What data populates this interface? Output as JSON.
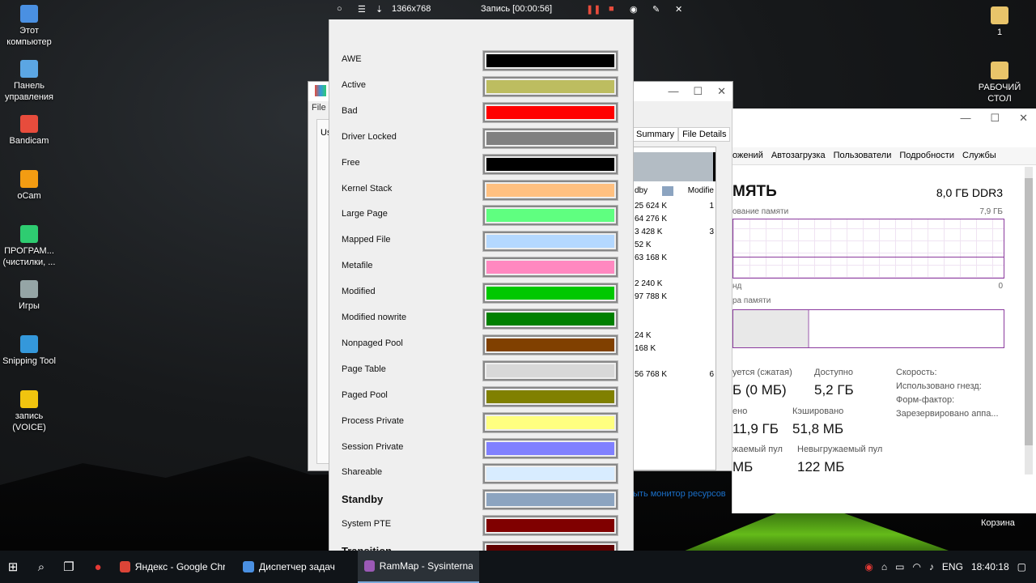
{
  "recorder": {
    "resolution": "1366x768",
    "recording": "Запись [00:00:56]"
  },
  "desktop_icons": [
    {
      "label": "Этот компьютер",
      "color": "#4a90e2"
    },
    {
      "label": "Панель управления",
      "color": "#5ba6e3"
    },
    {
      "label": "Bandicam",
      "color": "#e74c3c"
    },
    {
      "label": "oCam",
      "color": "#f39c12"
    },
    {
      "label": "ПРОГРАМ... (чистилки, ...",
      "color": "#2ecc71"
    },
    {
      "label": "Игры",
      "color": "#95a5a6"
    },
    {
      "label": "Snipping Tool",
      "color": "#3498db"
    },
    {
      "label": "запись (VOICE)",
      "color": "#f1c40f"
    }
  ],
  "right_icons": [
    {
      "label": "1"
    },
    {
      "label": "РАБОЧИЙ СТОЛ"
    }
  ],
  "rammap_window": {
    "menu": "File",
    "tabs": [
      "Summary",
      "File Details"
    ],
    "partial_tab": "Us",
    "header": {
      "col1": "dby",
      "col2": "Modifie"
    },
    "rows": [
      {
        "a": "25 624 K",
        "b": "1"
      },
      {
        "a": "64 276 K",
        "b": ""
      },
      {
        "a": "3 428 K",
        "b": "3"
      },
      {
        "a": "52 K",
        "b": ""
      },
      {
        "a": "63 168 K",
        "b": ""
      },
      {
        "a": "",
        "b": ""
      },
      {
        "a": "2 240 K",
        "b": ""
      },
      {
        "a": "97 788 K",
        "b": ""
      },
      {
        "a": "",
        "b": ""
      },
      {
        "a": "",
        "b": ""
      },
      {
        "a": "24 K",
        "b": ""
      },
      {
        "a": "168 K",
        "b": ""
      },
      {
        "a": "",
        "b": ""
      },
      {
        "a": "56 768 K",
        "b": "6"
      }
    ],
    "link": "ыть монитор ресурсов"
  },
  "task_manager": {
    "tabs": [
      "ожений",
      "Автозагрузка",
      "Пользователи",
      "Подробности",
      "Службы"
    ],
    "title": "мять",
    "spec": "8,0 ГБ DDR3",
    "usage_label": "ование памяти",
    "usage_max": "7,9 ГБ",
    "axis_left": "нд",
    "axis_right": "0",
    "composition_label": "ра памяти",
    "stats": {
      "in_use_label": "уется (сжатая)",
      "in_use_value": "Б (0 МБ)",
      "available_label": "Доступно",
      "available_value": "5,2 ГБ",
      "speed_label": "Скорость:",
      "slots_label": "Использовано гнезд:",
      "form_label": "Форм-фактор:",
      "reserved_label": "Зарезервировано аппа...",
      "committed_label": "ено",
      "committed_value": "11,9 ГБ",
      "cached_label": "Кэшировано",
      "cached_value": "51,8 МБ",
      "paged_label": "жаемый пул",
      "paged_value": "МБ",
      "nonpaged_label": "Невыгружаемый пул",
      "nonpaged_value": "122 МБ"
    }
  },
  "color_legend": [
    {
      "label": "AWE",
      "color": "#000000",
      "bold": false
    },
    {
      "label": "Active",
      "color": "#bdbd60",
      "bold": false
    },
    {
      "label": "Bad",
      "color": "#ff0000",
      "bold": false
    },
    {
      "label": "Driver Locked",
      "color": "#808080",
      "bold": false
    },
    {
      "label": "Free",
      "color": "#000000",
      "bold": false
    },
    {
      "label": "Kernel Stack",
      "color": "#ffc080",
      "bold": false
    },
    {
      "label": "Large Page",
      "color": "#5fff80",
      "bold": false
    },
    {
      "label": "Mapped File",
      "color": "#b4d8ff",
      "bold": false
    },
    {
      "label": "Metafile",
      "color": "#ff88c0",
      "bold": false
    },
    {
      "label": "Modified",
      "color": "#00c800",
      "bold": false
    },
    {
      "label": "Modified nowrite",
      "color": "#008000",
      "bold": false
    },
    {
      "label": "Nonpaged Pool",
      "color": "#804000",
      "bold": false
    },
    {
      "label": "Page Table",
      "color": "#d8d8d8",
      "bold": false
    },
    {
      "label": "Paged Pool",
      "color": "#808000",
      "bold": false
    },
    {
      "label": "Process Private",
      "color": "#ffff80",
      "bold": false
    },
    {
      "label": "Session Private",
      "color": "#8080ff",
      "bold": false
    },
    {
      "label": "Shareable",
      "color": "#d8ecff",
      "bold": false
    },
    {
      "label": "Standby",
      "color": "#8ca4c0",
      "bold": true
    },
    {
      "label": "System PTE",
      "color": "#800000",
      "bold": false
    },
    {
      "label": "Transition",
      "color": "#600000",
      "bold": true
    }
  ],
  "taskbar": {
    "apps": [
      {
        "label": "Яндекс - Google Chr...",
        "color": "#db4437",
        "active": false
      },
      {
        "label": "Диспетчер задач",
        "color": "#4a90e2",
        "active": false
      },
      {
        "label": "RamMap - Sysinterna...",
        "color": "#9b59b6",
        "active": true
      }
    ],
    "lang": "ENG",
    "time": "18:40:18"
  },
  "recycle_bin": "Корзина"
}
